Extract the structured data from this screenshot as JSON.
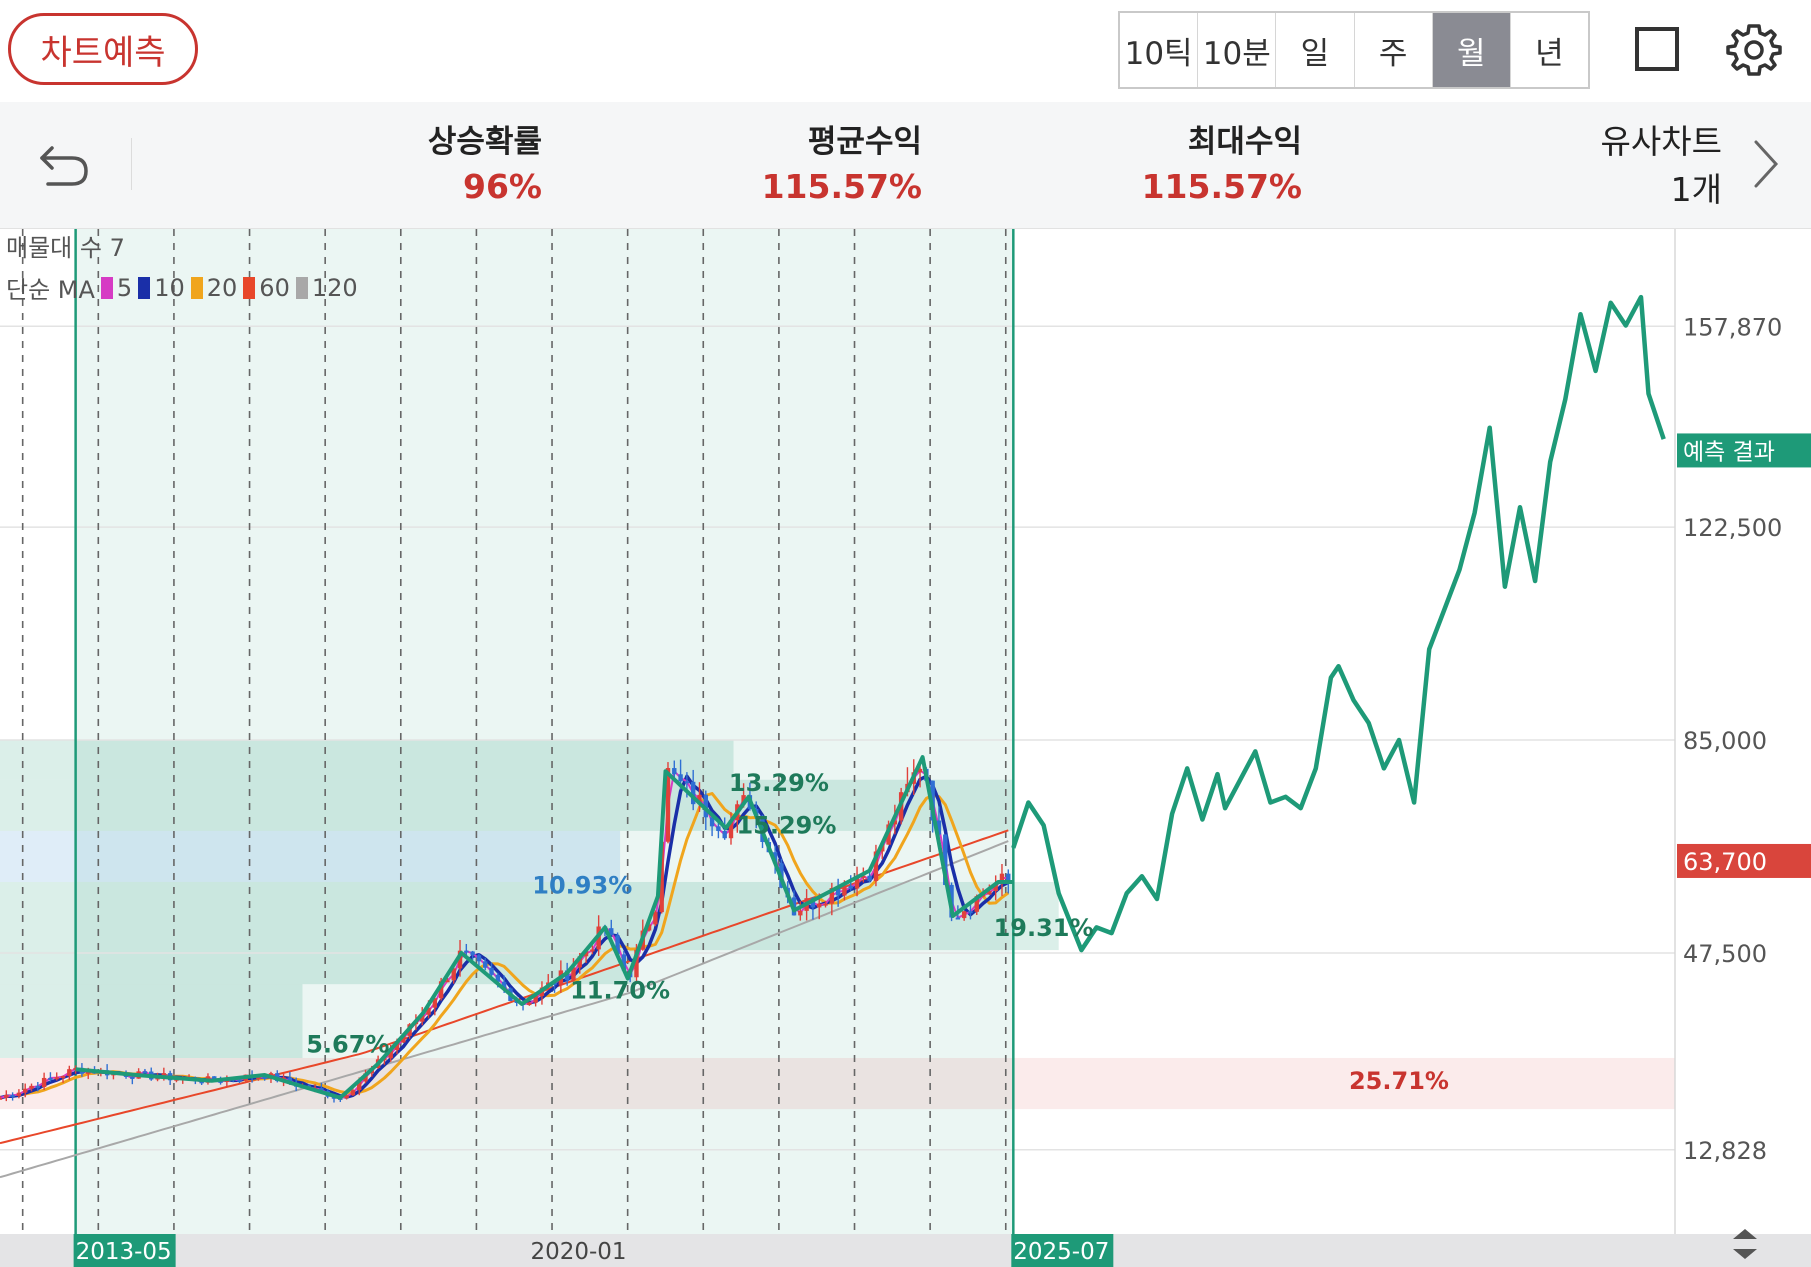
{
  "header": {
    "predict_button": "차트예측",
    "periods": [
      "10틱",
      "10분",
      "일",
      "주",
      "월",
      "년"
    ],
    "active_period": "월"
  },
  "stats": {
    "rise_probability": {
      "label": "상승확률",
      "value": "96%"
    },
    "avg_return": {
      "label": "평균수익",
      "value": "115.57%"
    },
    "max_return": {
      "label": "최대수익",
      "value": "115.57%"
    },
    "similar": {
      "label": "유사차트",
      "value": "1개"
    }
  },
  "legend": {
    "volume_profile": "매물대 수 7",
    "ma_label": "단순 MA",
    "ma_periods": [
      "5",
      "10",
      "20",
      "60",
      "120"
    ]
  },
  "colors": {
    "up": "#e0413b",
    "down": "#2f6fd3",
    "ma5": "#d63bc4",
    "ma10": "#1a2fa8",
    "ma20": "#f0a51d",
    "ma60": "#e8472a",
    "ma120": "#a8a8a8",
    "pattern": "#1e9a78",
    "accent_red": "#c8342f"
  },
  "chart_data": {
    "type": "line",
    "title": "",
    "x_axis_labels": [
      "2013-05",
      "2020-01",
      "2025-07"
    ],
    "y_ticks": [
      157870,
      122500,
      85000,
      47500,
      12828
    ],
    "ylim": [
      -2000,
      175000
    ],
    "current_price": {
      "label": "63,700",
      "value": 63700
    },
    "prediction_label": {
      "label": "예측 결과",
      "value": 136000
    },
    "volume_bands": [
      {
        "y0": 78000,
        "y1": 85000,
        "color": "#1e9a78"
      },
      {
        "y0": 69000,
        "y1": 78000,
        "color": "#1e9a78"
      },
      {
        "y0": 60000,
        "y1": 69000,
        "color": "#3b8fd4"
      },
      {
        "y0": 51000,
        "y1": 60000,
        "color": "#1e9a78"
      },
      {
        "y0": 48000,
        "y1": 51000,
        "color": "#1e9a78"
      },
      {
        "y0": 42000,
        "y1": 48000,
        "color": "#1e9a78"
      },
      {
        "y0": 29000,
        "y1": 42000,
        "color": "#1e9a78"
      },
      {
        "y0": 20000,
        "y1": 29000,
        "color": "#e98585"
      }
    ],
    "pattern_labels": [
      {
        "text": "5.67%",
        "x": 2016.8,
        "y": 30000,
        "color": "#1e7a5a"
      },
      {
        "text": "10.93%",
        "x": 2019.9,
        "y": 58000,
        "color": "#2f7fc4"
      },
      {
        "text": "11.70%",
        "x": 2020.4,
        "y": 39500,
        "color": "#1e7a5a"
      },
      {
        "text": "13.29%",
        "x": 2022.5,
        "y": 76000,
        "color": "#1e7a5a"
      },
      {
        "text": "15.29%",
        "x": 2022.6,
        "y": 68500,
        "color": "#1e7a5a"
      },
      {
        "text": "19.31%",
        "x": 2026.0,
        "y": 50500,
        "color": "#1e7a5a"
      },
      {
        "text": "25.71%",
        "x": 2030.7,
        "y": 23500,
        "color": "#c8342f"
      }
    ],
    "pattern_zigzag": [
      [
        2013.2,
        27000
      ],
      [
        2014.0,
        26000
      ],
      [
        2015.0,
        25000
      ],
      [
        2015.7,
        26000
      ],
      [
        2016.2,
        24000
      ],
      [
        2016.7,
        22000
      ],
      [
        2017.2,
        28000
      ],
      [
        2017.8,
        37000
      ],
      [
        2018.3,
        47500
      ],
      [
        2019.1,
        38500
      ],
      [
        2019.7,
        44000
      ],
      [
        2020.2,
        52000
      ],
      [
        2020.5,
        43000
      ],
      [
        2020.9,
        57500
      ],
      [
        2021.0,
        79500
      ],
      [
        2021.8,
        69500
      ],
      [
        2022.1,
        75000
      ],
      [
        2022.7,
        55000
      ],
      [
        2023.7,
        62000
      ],
      [
        2024.4,
        82000
      ],
      [
        2024.8,
        54000
      ],
      [
        2025.4,
        60000
      ],
      [
        2025.6,
        60000
      ]
    ],
    "series": [
      {
        "name": "prediction",
        "color": "#1e9a78",
        "points": [
          [
            2025.6,
            66000
          ],
          [
            2025.8,
            74000
          ],
          [
            2026.0,
            70000
          ],
          [
            2026.2,
            58000
          ],
          [
            2026.5,
            48000
          ],
          [
            2026.7,
            52000
          ],
          [
            2026.9,
            51000
          ],
          [
            2027.1,
            58000
          ],
          [
            2027.3,
            61000
          ],
          [
            2027.5,
            57000
          ],
          [
            2027.7,
            72000
          ],
          [
            2027.9,
            80000
          ],
          [
            2028.1,
            71000
          ],
          [
            2028.3,
            79000
          ],
          [
            2028.4,
            73000
          ],
          [
            2028.6,
            78000
          ],
          [
            2028.8,
            83000
          ],
          [
            2029.0,
            74000
          ],
          [
            2029.2,
            75000
          ],
          [
            2029.4,
            73000
          ],
          [
            2029.6,
            80000
          ],
          [
            2029.8,
            96000
          ],
          [
            2029.9,
            98000
          ],
          [
            2030.1,
            92000
          ],
          [
            2030.3,
            88000
          ],
          [
            2030.5,
            80000
          ],
          [
            2030.7,
            85000
          ],
          [
            2030.9,
            74000
          ],
          [
            2031.1,
            101000
          ],
          [
            2031.3,
            108000
          ],
          [
            2031.5,
            115000
          ],
          [
            2031.7,
            125000
          ],
          [
            2031.9,
            140000
          ],
          [
            2032.1,
            112000
          ],
          [
            2032.3,
            126000
          ],
          [
            2032.5,
            113000
          ],
          [
            2032.7,
            134000
          ],
          [
            2032.9,
            145000
          ],
          [
            2033.1,
            160000
          ],
          [
            2033.3,
            150000
          ],
          [
            2033.5,
            162000
          ],
          [
            2033.7,
            158000
          ],
          [
            2033.9,
            163000
          ],
          [
            2034.0,
            146000
          ],
          [
            2034.2,
            138000
          ]
        ]
      }
    ]
  }
}
